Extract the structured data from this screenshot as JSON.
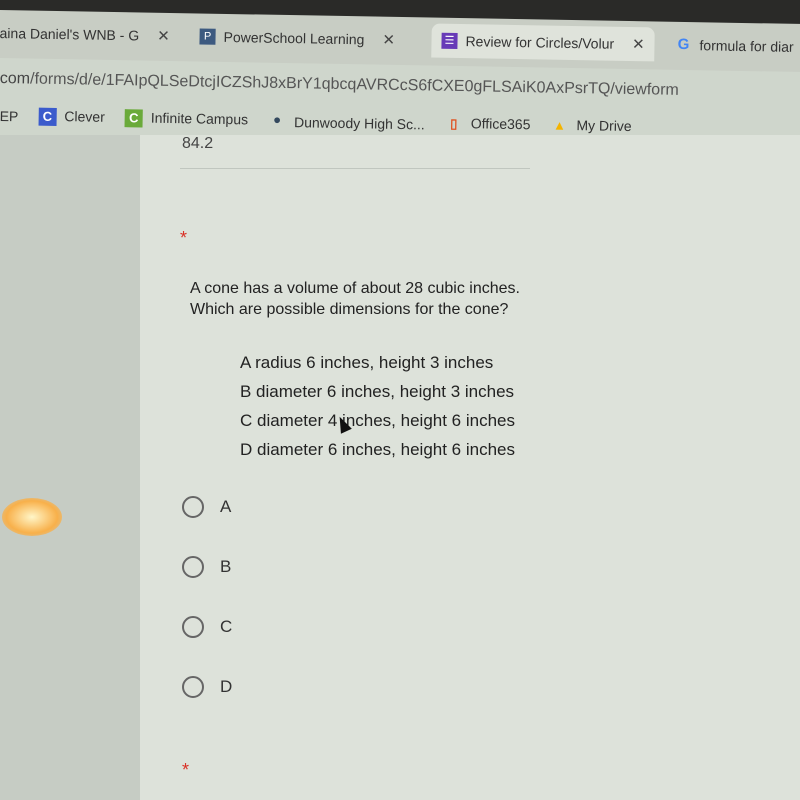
{
  "browser": {
    "tabs": [
      {
        "title": "aina Daniel's WNB - G",
        "icon": "google-docs-icon"
      },
      {
        "title": "PowerSchool Learning",
        "icon": "powerschool-icon"
      },
      {
        "title": "Review for Circles/Volur",
        "icon": "google-forms-icon",
        "active": true
      },
      {
        "title": "formula for diar",
        "icon": "google-icon"
      }
    ],
    "close_glyph": "✕",
    "url_prefix": "com",
    "url_path": "/forms/d/e/1FAIpQLSeDtcjICZShJ8xBrY1qbcqAVRCcS6fCXE0gFLSAiK0AxPsrTQ/viewform",
    "bookmarks": [
      {
        "label": "EP"
      },
      {
        "label": "Clever",
        "icon": "C",
        "color": "#3b5bcc"
      },
      {
        "label": "Infinite Campus",
        "icon": "C",
        "color": "#6aaa3a"
      },
      {
        "label": "Dunwoody High Sc...",
        "icon": "•",
        "color": "#34495e"
      },
      {
        "label": "Office365",
        "icon": "▯",
        "color": "#e0501e"
      },
      {
        "label": "My Drive",
        "icon": "▲",
        "color": "#f4b400"
      }
    ]
  },
  "form": {
    "previous_answer": "84.2",
    "required_marker": "*",
    "question": "A cone has a volume of about 28 cubic inches. Which are possible dimensions for the cone?",
    "choices_text": [
      "A radius 6 inches, height 3 inches",
      "B diameter 6 inches, height 3 inches",
      "C diameter 4 inches, height 6 inches",
      "D diameter 6 inches, height 6 inches"
    ],
    "options": [
      "A",
      "B",
      "C",
      "D"
    ],
    "accent": "#d93025"
  }
}
